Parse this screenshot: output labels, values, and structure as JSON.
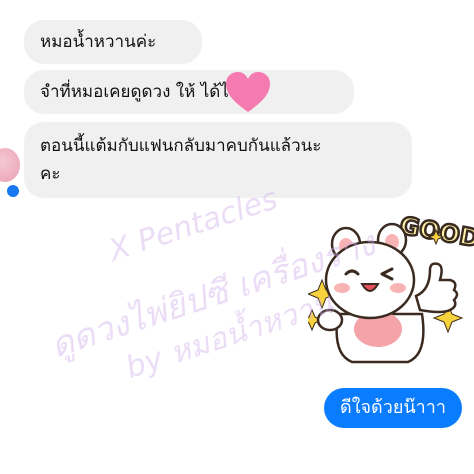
{
  "messages": [
    {
      "lines": [
        "หมอน้ำหวานค่ะ"
      ]
    },
    {
      "lines": [
        "จำที่หมอเคยดูดวง ให้ ได้ไมคะ"
      ]
    },
    {
      "lines": [
        "ตอนนี้แต้มกับแฟนกลับมาคบกันแล้วนะ",
        "คะ"
      ]
    }
  ],
  "sticker": {
    "text": "GOOD",
    "icon": "bear-thumbs-up-sticker"
  },
  "sent_message": "ดีใจด้วยน๊าาา",
  "watermark": {
    "line1": "X Pentacles",
    "line2": "ดูดวงไพ่ยิปซี เครื่องราง",
    "line3": "by หมอน้ำหวาน"
  },
  "colors": {
    "received_bubble": "#f0f0f0",
    "sent_bubble": "#0a7cff",
    "heart": "#f47ab0",
    "watermark": "#d2afeb"
  }
}
